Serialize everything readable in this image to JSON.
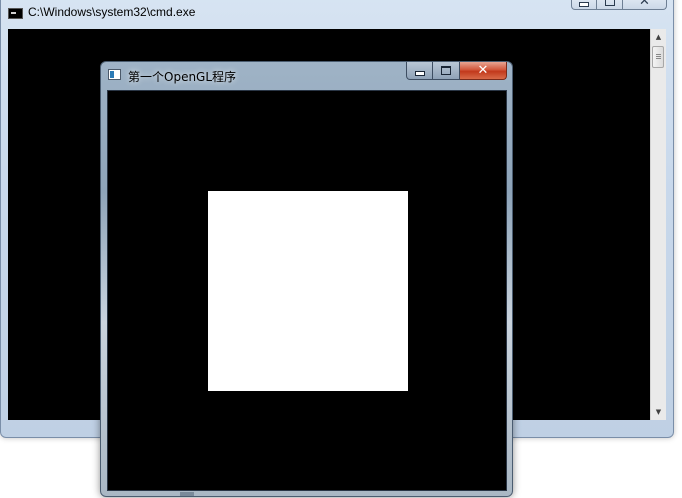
{
  "cmd_window": {
    "title": "C:\\Windows\\system32\\cmd.exe",
    "icon": "console-icon",
    "controls": {
      "minimize_icon": "minimize-icon",
      "maximize_icon": "maximize-icon",
      "close_glyph": "✕"
    },
    "scrollbar": {
      "up_arrow": "▲",
      "down_arrow": "▼"
    },
    "console_background": "#000000"
  },
  "gl_window": {
    "title": "第一个OpenGL程序",
    "icon": "application-icon",
    "controls": {
      "minimize_icon": "minimize-icon",
      "maximize_icon": "maximize-icon",
      "close_glyph": "✕"
    },
    "canvas_background": "#000000",
    "square_color": "#ffffff"
  }
}
